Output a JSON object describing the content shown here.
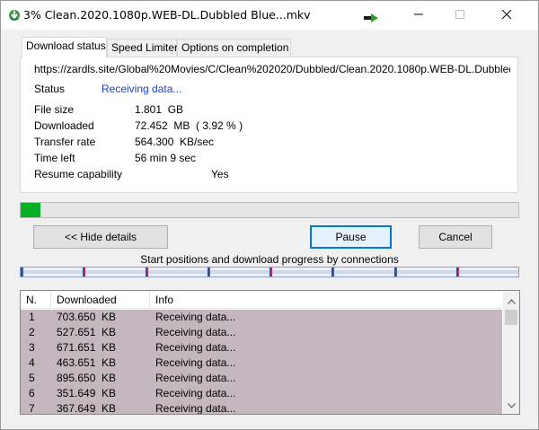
{
  "window": {
    "title": "3% Clean.2020.1080p.WEB-DL.Dubbled Blue...mkv"
  },
  "tabs": [
    {
      "label": "Download status",
      "active": true
    },
    {
      "label": "Speed Limiter",
      "active": false
    },
    {
      "label": "Options on completion",
      "active": false
    }
  ],
  "status_panel": {
    "url": "https://zardls.site/Global%20Movies/C/Clean%202020/Dubbled/Clean.2020.1080p.WEB-DL.Dubbled%",
    "status_label": "Status",
    "status_value": "Receiving data...",
    "file_size_label": "File size",
    "file_size_value": "1.801  GB",
    "downloaded_label": "Downloaded",
    "downloaded_value": "72.452  MB  ( 3.92 % )",
    "transfer_rate_label": "Transfer rate",
    "transfer_rate_value": "564.300  KB/sec",
    "time_left_label": "Time left",
    "time_left_value": "56 min 9 sec",
    "resume_label": "Resume capability",
    "resume_value": "Yes"
  },
  "progress": {
    "fraction": 0.0392
  },
  "buttons": {
    "hide_details": "<< Hide details",
    "pause": "Pause",
    "cancel": "Cancel"
  },
  "connections": {
    "caption": "Start positions and download progress by connections"
  },
  "list": {
    "columns": [
      "N.",
      "Downloaded",
      "Info"
    ],
    "rows": [
      {
        "n": "1",
        "downloaded": "703.650  KB",
        "info": "Receiving data..."
      },
      {
        "n": "2",
        "downloaded": "527.651  KB",
        "info": "Receiving data..."
      },
      {
        "n": "3",
        "downloaded": "671.651  KB",
        "info": "Receiving data..."
      },
      {
        "n": "4",
        "downloaded": "463.651  KB",
        "info": "Receiving data..."
      },
      {
        "n": "5",
        "downloaded": "895.650  KB",
        "info": "Receiving data..."
      },
      {
        "n": "6",
        "downloaded": "351.649  KB",
        "info": "Receiving data..."
      },
      {
        "n": "7",
        "downloaded": "367.649  KB",
        "info": "Receiving data..."
      }
    ]
  },
  "colors": {
    "progress_fill": "#06b025",
    "status_value": "#1f3fbf",
    "row_background": "#c5b7c0",
    "connection_marker_blue": "#2f49a8",
    "connection_marker_red": "#d0304a"
  },
  "icons": {
    "app": "download-arrow-icon",
    "extension": "green-arrow-icon",
    "minimize": "minimize-icon",
    "maximize": "maximize-icon",
    "close": "close-icon",
    "scroll_up": "chevron-up-icon",
    "scroll_down": "chevron-down-icon"
  }
}
